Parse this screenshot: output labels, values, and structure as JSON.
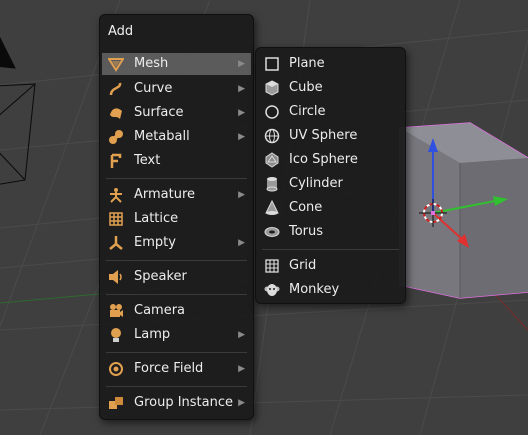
{
  "add_menu": {
    "title": "Add",
    "items": [
      {
        "label": "Mesh",
        "icon": "mesh-icon",
        "submenu": true,
        "active": true
      },
      {
        "label": "Curve",
        "icon": "curve-icon",
        "submenu": true
      },
      {
        "label": "Surface",
        "icon": "surface-icon",
        "submenu": true
      },
      {
        "label": "Metaball",
        "icon": "metaball-icon",
        "submenu": true
      },
      {
        "label": "Text",
        "icon": "text-icon",
        "submenu": false
      },
      {
        "label": "Armature",
        "icon": "armature-icon",
        "submenu": true
      },
      {
        "label": "Lattice",
        "icon": "lattice-icon",
        "submenu": false
      },
      {
        "label": "Empty",
        "icon": "empty-icon",
        "submenu": true
      },
      {
        "label": "Speaker",
        "icon": "speaker-icon",
        "submenu": false
      },
      {
        "label": "Camera",
        "icon": "camera-icon",
        "submenu": false
      },
      {
        "label": "Lamp",
        "icon": "lamp-icon",
        "submenu": true
      },
      {
        "label": "Force Field",
        "icon": "force-field-icon",
        "submenu": true
      },
      {
        "label": "Group Instance",
        "icon": "group-instance-icon",
        "submenu": true
      }
    ]
  },
  "mesh_menu": {
    "items": [
      {
        "label": "Plane",
        "icon": "plane-icon"
      },
      {
        "label": "Cube",
        "icon": "cube-icon"
      },
      {
        "label": "Circle",
        "icon": "circle-icon"
      },
      {
        "label": "UV Sphere",
        "icon": "uv-sphere-icon"
      },
      {
        "label": "Ico Sphere",
        "icon": "ico-sphere-icon"
      },
      {
        "label": "Cylinder",
        "icon": "cylinder-icon"
      },
      {
        "label": "Cone",
        "icon": "cone-icon"
      },
      {
        "label": "Torus",
        "icon": "torus-icon"
      },
      {
        "label": "Grid",
        "icon": "grid-icon"
      },
      {
        "label": "Monkey",
        "icon": "monkey-icon"
      }
    ]
  },
  "colors": {
    "viewport_bg": "#3f3f3f",
    "menu_bg": "#1c1c1c",
    "menu_highlight": "#5b5b5b",
    "icon_orange": "#e0a050",
    "selection_pink": "#e070e0",
    "axis_red": "#e03030",
    "axis_green": "#30c030",
    "axis_blue": "#3050e0"
  }
}
